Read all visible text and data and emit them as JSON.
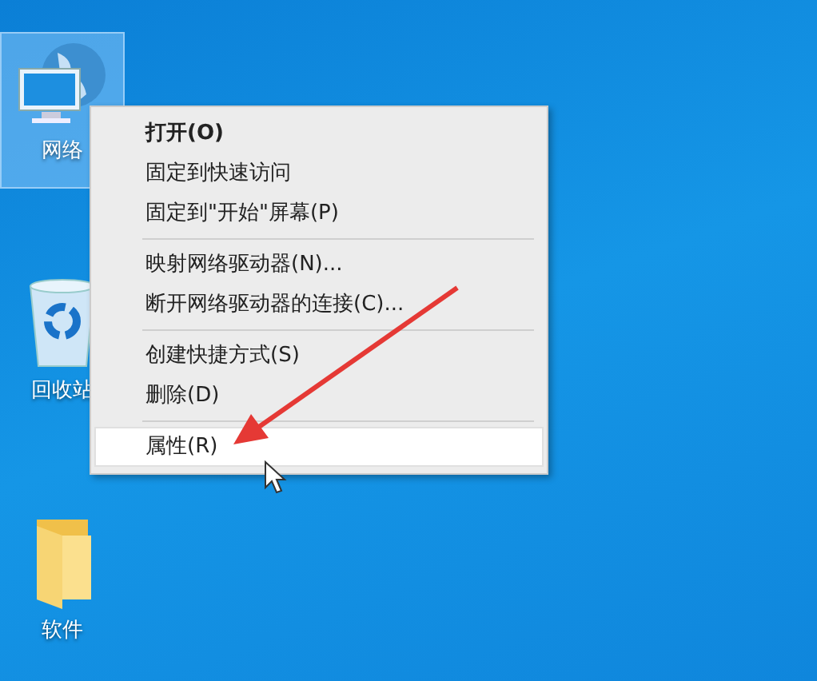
{
  "desktop_icons": [
    {
      "kind": "network",
      "label": "网络",
      "selected": true
    },
    {
      "kind": "recycle-bin",
      "label": "回收站",
      "selected": false
    },
    {
      "kind": "folder",
      "label": "软件",
      "selected": false
    }
  ],
  "context_menu": {
    "items": [
      {
        "kind": "item",
        "label": "打开(O)",
        "default": true,
        "selected": false
      },
      {
        "kind": "item",
        "label": "固定到快速访问",
        "default": false,
        "selected": false
      },
      {
        "kind": "item",
        "label": "固定到\"开始\"屏幕(P)",
        "default": false,
        "selected": false
      },
      {
        "kind": "separator"
      },
      {
        "kind": "item",
        "label": "映射网络驱动器(N)...",
        "default": false,
        "selected": false
      },
      {
        "kind": "item",
        "label": "断开网络驱动器的连接(C)...",
        "default": false,
        "selected": false
      },
      {
        "kind": "separator"
      },
      {
        "kind": "item",
        "label": "创建快捷方式(S)",
        "default": false,
        "selected": false
      },
      {
        "kind": "item",
        "label": "删除(D)",
        "default": false,
        "selected": false
      },
      {
        "kind": "separator"
      },
      {
        "kind": "item",
        "label": "属性(R)",
        "default": false,
        "selected": true
      }
    ]
  }
}
